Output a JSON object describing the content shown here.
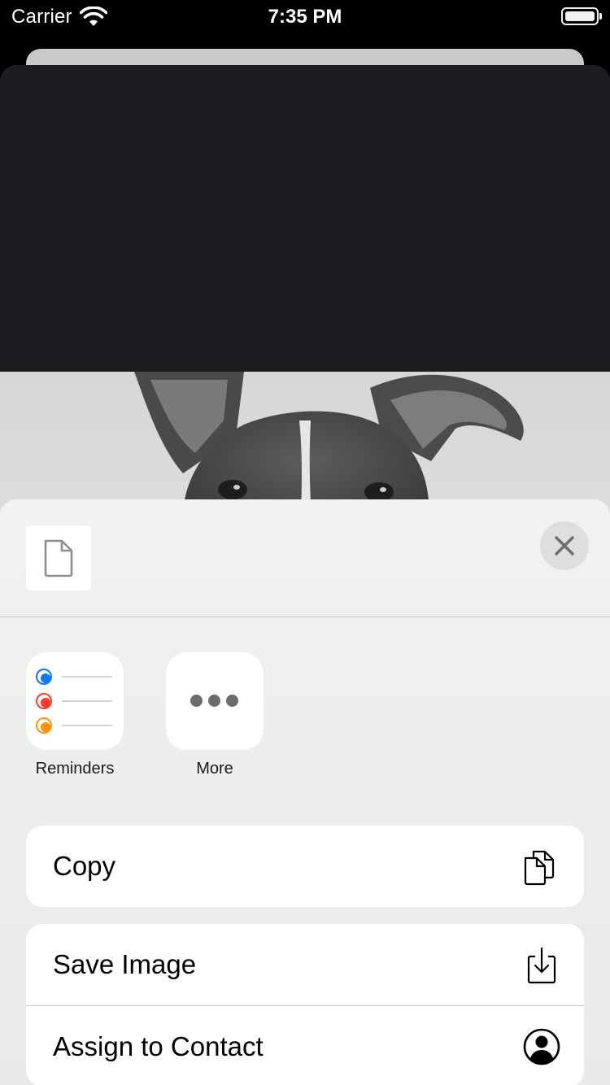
{
  "status_bar": {
    "carrier": "Carrier",
    "time": "7:35 PM"
  },
  "header": {
    "document_icon": "doc-icon",
    "close_icon": "close-icon"
  },
  "apps": [
    {
      "label": "Reminders",
      "icon": "reminders-icon"
    },
    {
      "label": "More",
      "icon": "ellipsis-icon"
    }
  ],
  "actions": {
    "copy": {
      "label": "Copy",
      "icon": "copy-icon"
    },
    "save_image": {
      "label": "Save Image",
      "icon": "download-icon"
    },
    "assign_contact": {
      "label": "Assign to Contact",
      "icon": "person-circle-icon"
    }
  },
  "colors": {
    "reminder_blue": "#0a7aff",
    "reminder_red": "#ff3b30",
    "reminder_orange": "#ff9500",
    "dark_background": "#1c1d21"
  }
}
